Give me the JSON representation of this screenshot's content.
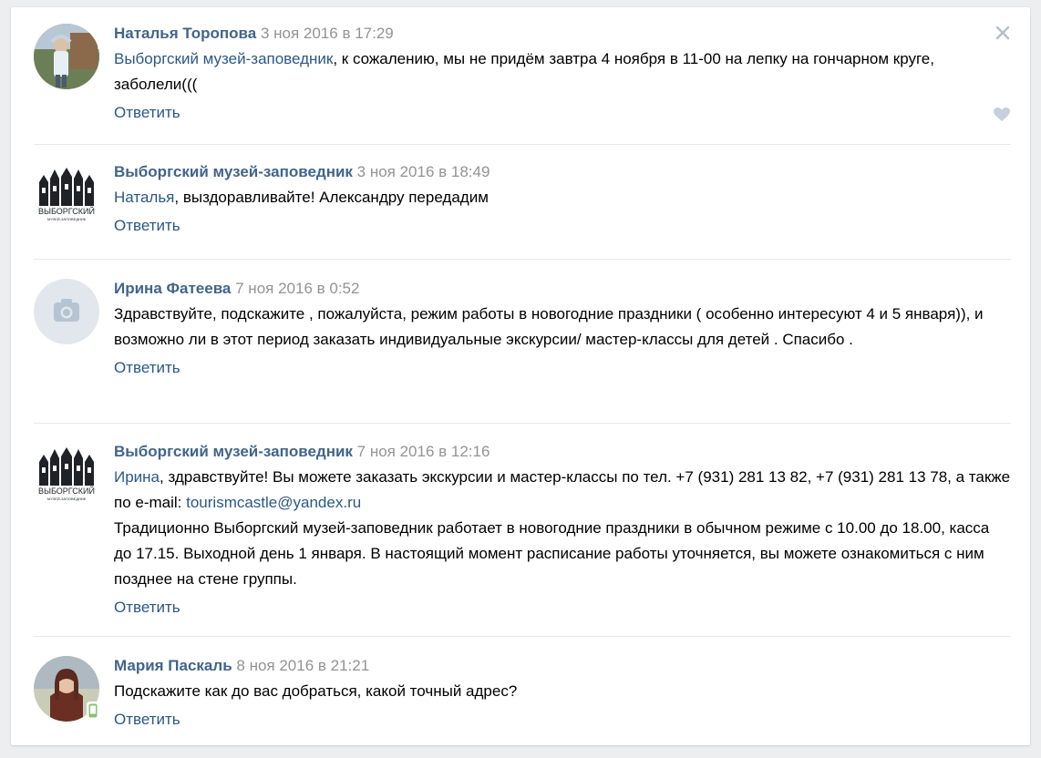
{
  "reply_label": "Ответить",
  "comments": [
    {
      "author": "Наталья Торопова",
      "date": "3 ноя 2016 в 17:29",
      "text_mention": "Выборгский музей-заповедник",
      "text_rest": ", к сожалению, мы не придём завтра 4 ноября в 11-00 на лепку на гончарном круге, заболели((("
    },
    {
      "author": "Выборгский музей-заповедник",
      "date": "3 ноя 2016 в 18:49",
      "text_mention": "Наталья",
      "text_rest": ", выздоравливайте! Александру передадим",
      "logo_text_1": "ВЫБОРГСКИЙ",
      "logo_text_2": "МУЗЕЙ-ЗАПОВЕДНИК"
    },
    {
      "author": "Ирина Фатеева",
      "date": "7 ноя 2016 в 0:52",
      "text": "Здравствуйте, подскажите , пожалуйста, режим работы в новогодние праздники ( особенно интересуют 4 и 5 января)), и возможно ли в этот период заказать индивидуальные экскурсии/ мастер-классы для детей . Спасибо ."
    },
    {
      "author": "Выборгский музей-заповедник",
      "date": "7 ноя 2016 в 12:16",
      "text_mention": "Ирина",
      "text_rest": ", здравствуйте! Вы можете заказать экскурсии и мастер-классы по тел. +7 (931) 281 13 82, +7 (931) 281 13 78, а также по e-mail: ",
      "email": "tourismcastle@yandex.ru",
      "text_2": "Традиционно Выборгский музей-заповедник работает в новогодние праздники в обычном режиме с 10.00 до 18.00, касса до 17.15. Выходной день 1 января. В настоящий момент расписание работы уточняется, вы можете ознакомиться с ним позднее на стене группы.",
      "logo_text_1": "ВЫБОРГСКИЙ",
      "logo_text_2": "МУЗЕЙ-ЗАПОВЕДНИК"
    },
    {
      "author": "Мария Паскаль",
      "date": "8 ноя 2016 в 21:21",
      "text": "Подскажите как до вас добраться, какой точный адрес?"
    }
  ],
  "colors": {
    "author": "#42648b",
    "link": "#2a5885",
    "date": "#939393",
    "separator": "#e7e8ec"
  },
  "icons": [
    "close-icon",
    "like-icon",
    "camera-icon",
    "mobile-online-icon"
  ]
}
